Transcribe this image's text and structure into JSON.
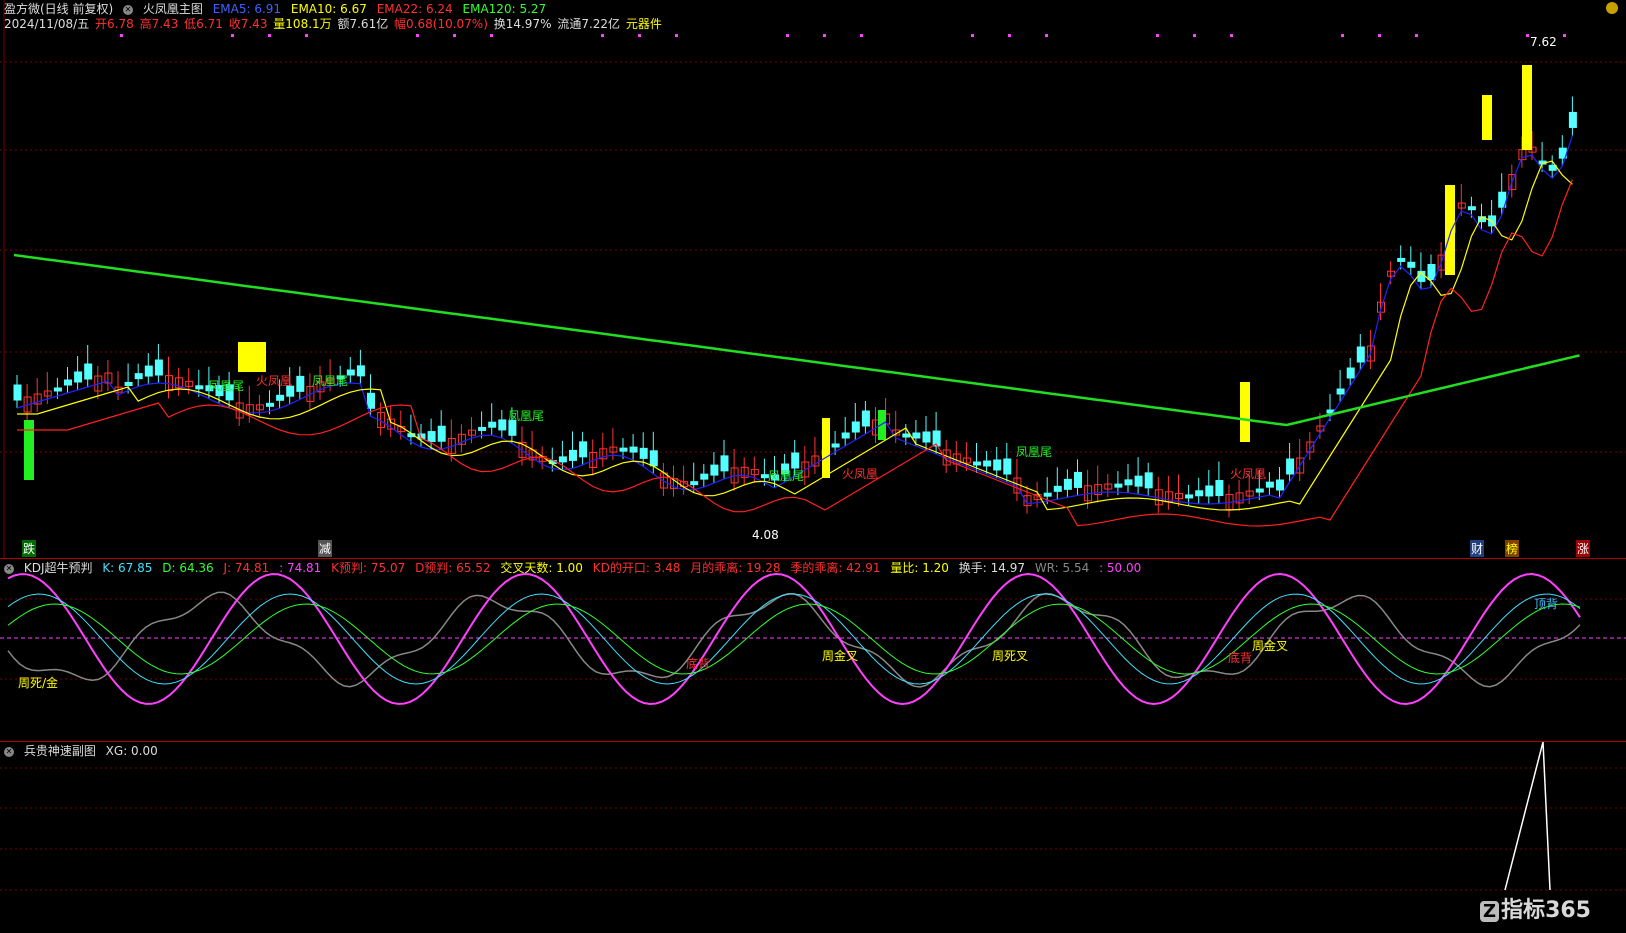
{
  "header": {
    "app": "盈方微(日线 前复权)",
    "indicator": "火凤凰主图",
    "ema5": "EMA5: 6.91",
    "ema10": "EMA10: 6.67",
    "ema22": "EMA22: 6.24",
    "ema120": "EMA120: 5.27",
    "date": "2024/11/08/五",
    "open": "开6.78",
    "high": "高7.43",
    "low": "低6.71",
    "close": "收7.43",
    "vol": "量108.1万",
    "amount": "额7.61亿",
    "change": "幅0.68(10.07%)",
    "turnover": "换14.97%",
    "float": "流通7.22亿",
    "component": "元器件"
  },
  "main_annotations": {
    "high_price": "7.62",
    "low_price": "4.08",
    "tag_die": "跌",
    "tag_jian": "减",
    "tag_cai": "财",
    "tag_bang": "榜",
    "tag_zhang": "涨",
    "phoenix_tail": "凤凰尾",
    "fire_phoenix": "火凤凰"
  },
  "kdj": {
    "title": "KDJ超牛预判",
    "k": "K: 67.85",
    "d": "D: 64.36",
    "j": "J: 74.81",
    "j2": ": 74.81",
    "kpred": "K预判: 75.07",
    "dpred": "D预判: 65.52",
    "cross_days": "交叉天数: 1.00",
    "kd_open": "KD的开口: 3.48",
    "month_dev": "月的乖离: 19.28",
    "season_dev": "季的乖离: 42.91",
    "vol_ratio": "量比: 1.20",
    "turnover": "换手: 14.97",
    "wr": "WR: 5.54",
    "mid": ": 50.00",
    "labels": {
      "week_dead_gold": "周死/金",
      "week_gold": "周金叉",
      "week_dead": "周死叉",
      "week_gold2": "周金叉",
      "top_div": "顶背",
      "bottom_div": "底背",
      "bottom_div2": "底背"
    }
  },
  "xg": {
    "title": "兵贵神速副图",
    "xg": "XG: 0.00"
  },
  "watermark": "指标365",
  "colors": {
    "up": "#ff3333",
    "down": "#54ffff",
    "ema5": "#2222ff",
    "ema10": "#ffff00",
    "ema22": "#ff2020",
    "ema120": "#22dd22",
    "grid": "#7a0000"
  }
}
